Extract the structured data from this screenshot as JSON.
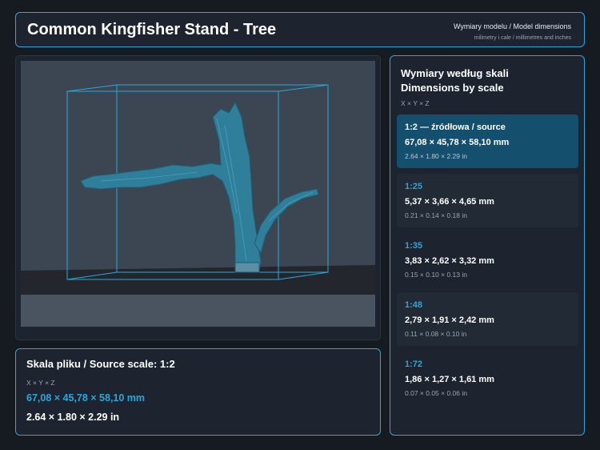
{
  "header": {
    "title": "Common Kingfisher Stand - Tree",
    "subtitle": "Wymiary modelu / Model dimensions",
    "units_note": "milimetry i cale / millimetres and inches"
  },
  "viewer": {
    "model_color": "#2f7f9a",
    "bbox_color": "#2aa7d8",
    "background_color": "#3c4652",
    "floor_color": "#23272d"
  },
  "source": {
    "title": "Skala pliku / Source scale: 1:2",
    "axes": "X × Y × Z",
    "mm": "67,08 × 45,78 × 58,10 mm",
    "inches": "2.64 × 1.80 × 2.29 in"
  },
  "scales": {
    "title_pl": "Wymiary według skali",
    "title_en": "Dimensions by scale",
    "axes": "X × Y × Z",
    "items": [
      {
        "label": "1:2  —  źródłowa / source",
        "mm": "67,08 × 45,78 × 58,10 mm",
        "inches": "2.64 × 1.80 × 2.29 in",
        "active": true
      },
      {
        "label": "1:25",
        "mm": "5,37 × 3,66 × 4,65 mm",
        "inches": "0.21 × 0.14 × 0.18 in",
        "active": false
      },
      {
        "label": "1:35",
        "mm": "3,83 × 2,62 × 3,32 mm",
        "inches": "0.15 × 0.10 × 0.13 in",
        "active": false
      },
      {
        "label": "1:48",
        "mm": "2,79 × 1,91 × 2,42 mm",
        "inches": "0.11 × 0.08 × 0.10 in",
        "active": false
      },
      {
        "label": "1:72",
        "mm": "1,86 × 1,27 × 1,61 mm",
        "inches": "0.07 × 0.05 × 0.06 in",
        "active": false
      }
    ]
  }
}
